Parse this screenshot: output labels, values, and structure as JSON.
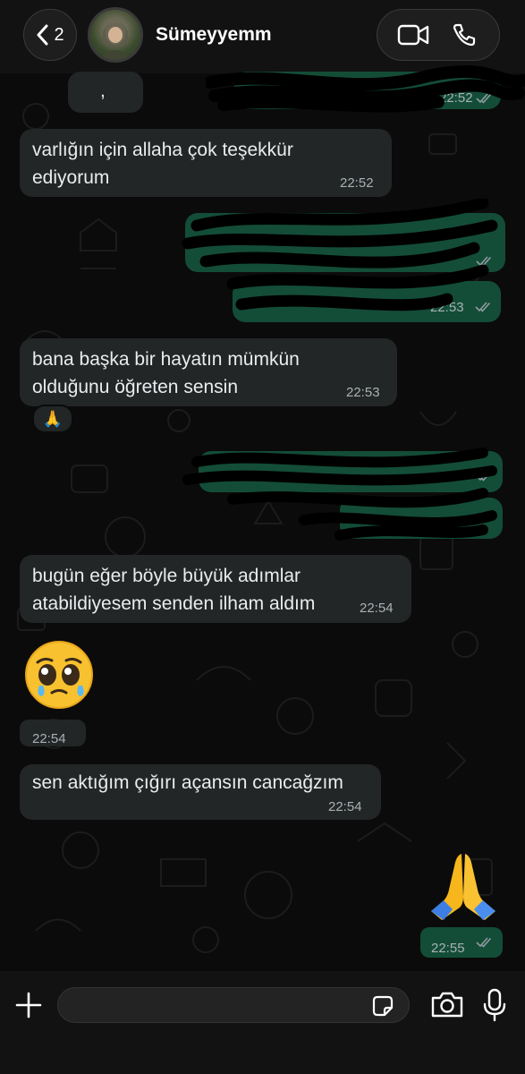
{
  "header": {
    "back_count": "2",
    "contact_name": "Sümeyyemm"
  },
  "messages": [
    {
      "dir": "in",
      "text": ",",
      "time": ""
    },
    {
      "dir": "out",
      "text": "",
      "time": "22:52",
      "redacted": true
    },
    {
      "dir": "in",
      "text": "varlığın için allaha çok teşekkür ediyorum",
      "time": "22:52"
    },
    {
      "dir": "out",
      "text": "",
      "time": "",
      "redacted": true
    },
    {
      "dir": "out",
      "text": "",
      "time": "22:53",
      "redacted": true
    },
    {
      "dir": "in",
      "text": "bana başka bir hayatın mümkün olduğunu öğreten sensin",
      "time": "22:53"
    },
    {
      "dir": "in",
      "text": "🙏",
      "time": "",
      "reaction": true
    },
    {
      "dir": "out",
      "text": "",
      "time": "",
      "redacted": true
    },
    {
      "dir": "out",
      "text": "",
      "time": "",
      "redacted": true
    },
    {
      "dir": "in",
      "text": "bugün eğer böyle büyük adımlar atabildiyesem senden ilham aldım",
      "time": "22:54"
    },
    {
      "dir": "in",
      "text": "🥹",
      "time": "22:54",
      "emoji_only": true
    },
    {
      "dir": "in",
      "text": "sen aktığım çığırı açansın cancağzım",
      "time": "22:54"
    },
    {
      "dir": "out",
      "text": "🙏",
      "time": "22:55",
      "emoji_only": true
    }
  ],
  "msg": {
    "m1": "varlığın için allaha çok teşekkür",
    "m1b": "ediyorum",
    "m2": "bana başka bir hayatın mümkün",
    "m2b": "olduğunu öğreten sensin",
    "m3": "bugün eğer böyle büyük adımlar",
    "m3b": "atabildiyesem senden ilham aldım",
    "m4": "sen aktığım çığırı açansın cancağzım",
    "comma": ",",
    "reaction": "🙏",
    "emoji_in": "🥹",
    "emoji_out": "🙏",
    "t_0252a": "22:52",
    "t_0252": "22:52",
    "t_0253a": "22:53",
    "t_0253": "22:53",
    "t_0254a": "22:54",
    "t_0254b": "22:54",
    "t_0254c": "22:54",
    "t_0255": "22:55"
  },
  "colors": {
    "incoming": "#232626",
    "outgoing": "#134d37",
    "read_ticks": "#8f9aa0"
  },
  "icons": [
    "chevron-left-icon",
    "video-call-icon",
    "phone-icon",
    "plus-icon",
    "sticker-icon",
    "camera-icon",
    "microphone-icon"
  ]
}
